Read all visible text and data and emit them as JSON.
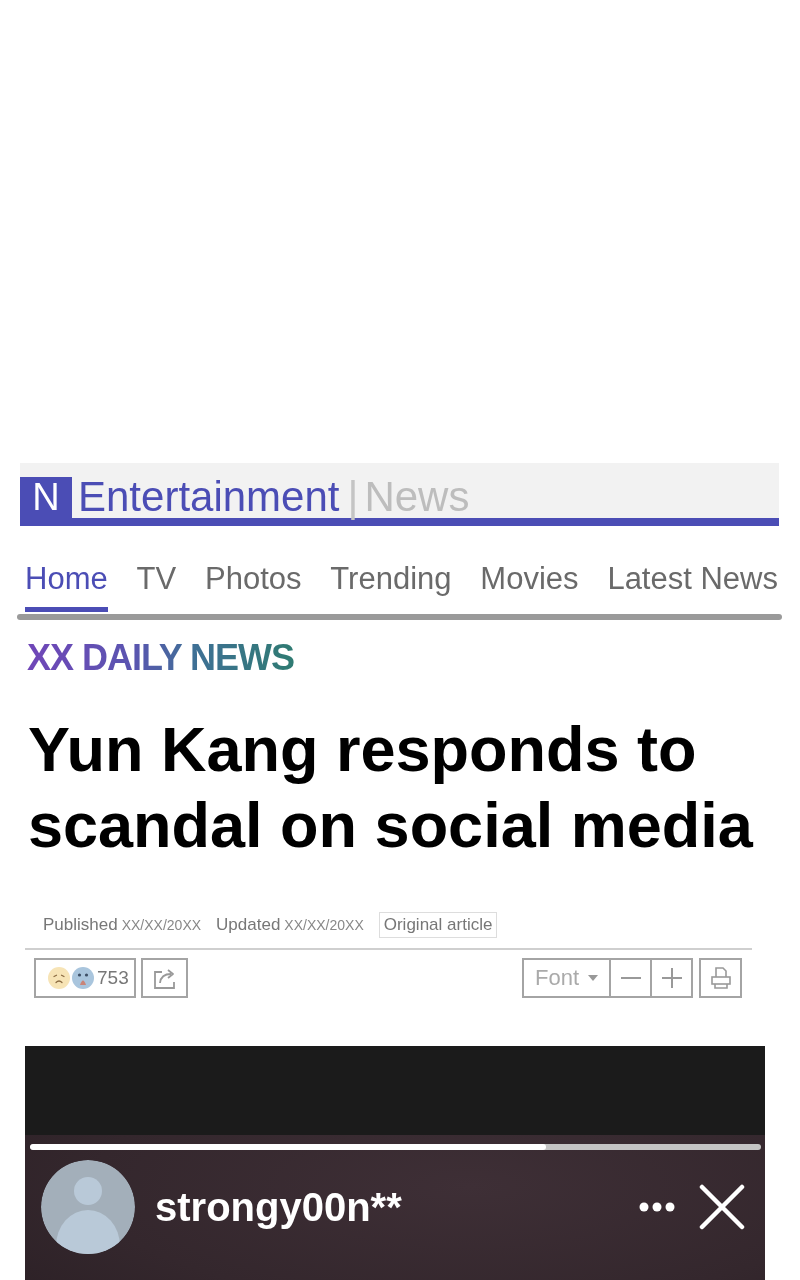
{
  "header": {
    "logo": "N",
    "section": "Entertainment",
    "separator": "|",
    "site": "News"
  },
  "nav": {
    "tabs": [
      {
        "label": "Home",
        "selected": true
      },
      {
        "label": "TV",
        "selected": false
      },
      {
        "label": "Photos",
        "selected": false
      },
      {
        "label": "Trending",
        "selected": false
      },
      {
        "label": "Movies",
        "selected": false
      },
      {
        "label": "Latest News",
        "selected": false
      }
    ]
  },
  "article": {
    "source": "XX DAILY NEWS",
    "headline": "Yun Kang responds to scandal on social media",
    "dates": [
      {
        "label": "Published",
        "value": "XX/XX/20XX"
      },
      {
        "label": "Updated",
        "value": "XX/XX/20XX"
      }
    ],
    "original_link": "Original article",
    "reaction_count": "753",
    "font_button": "Font"
  },
  "story": {
    "level": 0.706,
    "username": "strongy00n**"
  }
}
